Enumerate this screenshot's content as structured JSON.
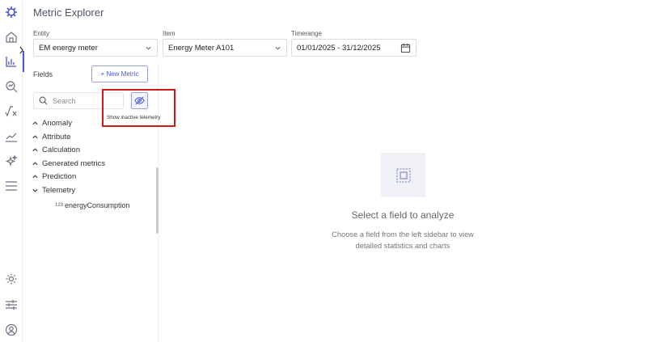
{
  "app": {
    "title": "Metric Explorer"
  },
  "rail": {
    "items": [
      {
        "icon": "logo-icon"
      },
      {
        "icon": "home-icon"
      },
      {
        "icon": "bar-chart-icon"
      },
      {
        "icon": "search-chart-icon"
      },
      {
        "icon": "formula-icon"
      },
      {
        "icon": "trend-icon"
      },
      {
        "icon": "sparkle-icon"
      },
      {
        "icon": "menu-icon"
      },
      {
        "icon": "gear-icon"
      },
      {
        "icon": "sliders-icon"
      },
      {
        "icon": "user-icon"
      }
    ],
    "active": "bar-chart-icon"
  },
  "filters": {
    "entity": {
      "label": "Entity",
      "value": "EM energy meter"
    },
    "item": {
      "label": "Item",
      "value": "Energy Meter A101"
    },
    "timerange": {
      "label": "Timerange",
      "value": "01/01/2025 - 31/12/2025"
    }
  },
  "fields": {
    "label": "Fields",
    "new_metric_label": "+ New Metric",
    "search_placeholder": "Search",
    "tooltip": "Show inactive telemetry",
    "groups": [
      {
        "label": "Anomaly",
        "expanded": false
      },
      {
        "label": "Attribute",
        "expanded": false
      },
      {
        "label": "Calculation",
        "expanded": false
      },
      {
        "label": "Generated metrics",
        "expanded": false
      },
      {
        "label": "Prediction",
        "expanded": false
      },
      {
        "label": "Telemetry",
        "expanded": true
      }
    ],
    "telemetry_items": [
      {
        "type_badge": "123",
        "label": "energyConsumption"
      }
    ]
  },
  "empty_state": {
    "title": "Select a field to analyze",
    "description": "Choose a field from the left sidebar to view detailed statistics and charts"
  },
  "colors": {
    "accent": "#4a57d1",
    "highlight": "#d01919"
  }
}
